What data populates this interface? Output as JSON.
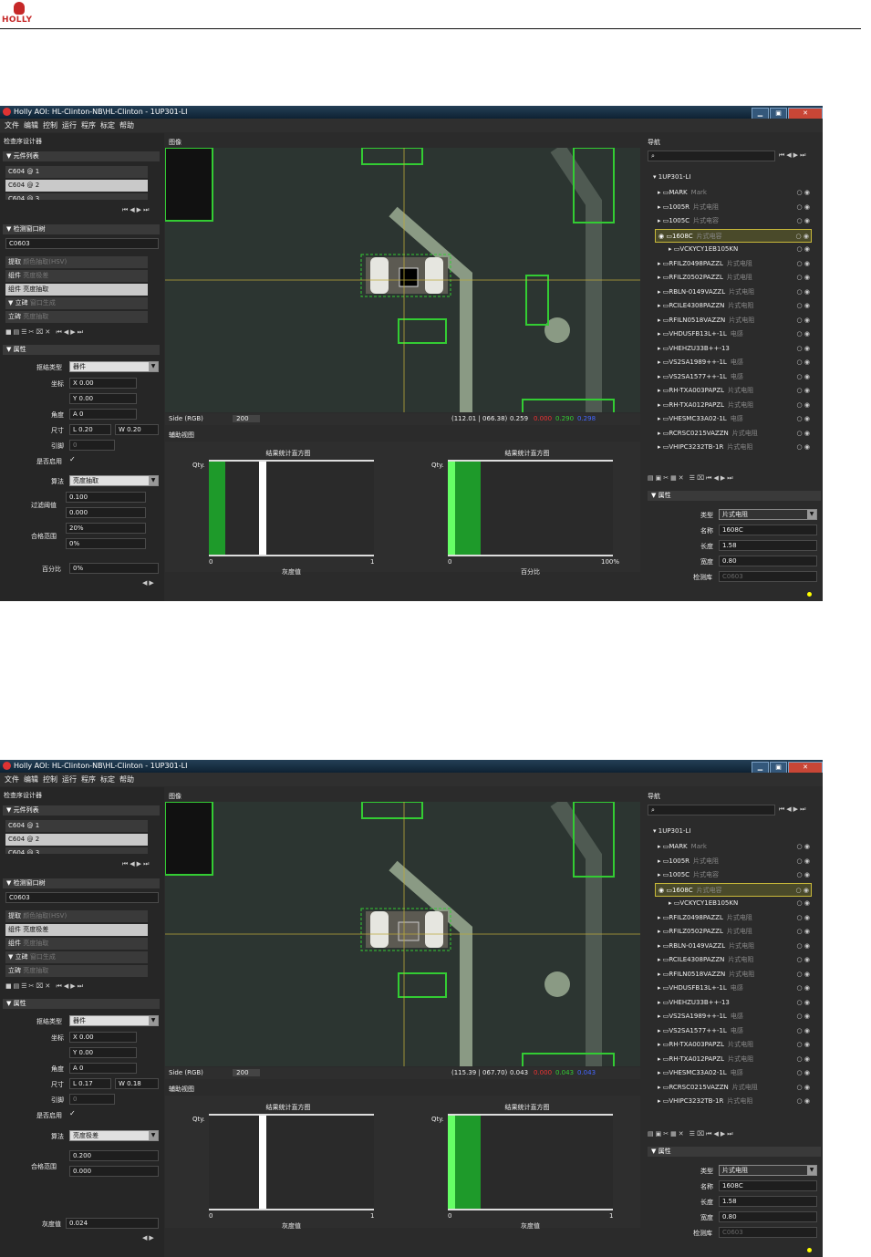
{
  "brand": "HOLLY",
  "app": {
    "title": "Holly AOI: HL-Clinton-NB\\HL-Clinton - 1UP301-LI",
    "menus": [
      "文件",
      "编辑",
      "控制",
      "运行",
      "程序",
      "标定",
      "帮助"
    ],
    "sections": {
      "designer": "检查序设计器",
      "image": "图像",
      "nav": "导航",
      "aux": "辅助视图",
      "component_list": "▼ 元件列表",
      "window": "▼ 检测窗口树",
      "props": "▼ 属性",
      "nav_props": "▼ 属性"
    },
    "component_list": [
      "C604  @ 1",
      "C604  @ 2",
      "C604  @ 3"
    ],
    "package": "C0603",
    "tree": [
      {
        "name": "提取",
        "desc": "颜色抽取(HSV)"
      },
      {
        "name": "组件",
        "desc": "亮度极差"
      },
      {
        "name": "组件",
        "desc": "亮度抽取"
      },
      {
        "name": "▼ 立碑",
        "desc": "窗口生成"
      },
      {
        "name": "立碑",
        "desc": "亮度抽取"
      }
    ],
    "prop_labels": {
      "shape": "抠结类型",
      "coord": "坐标",
      "angle": "角度",
      "size": "尺寸",
      "index": "引脚",
      "enabled": "是否启用",
      "algo": "算法",
      "filter": "过滤阈值",
      "range": "合格范围",
      "percent": "百分比",
      "gray": "灰度值"
    },
    "shape_value": "器件",
    "side_label": "Side (RGB)",
    "side_value": "200",
    "hist_title": "结果统计直方图",
    "qty": "Qty.",
    "gray_label": "灰度值",
    "pct_label": "百分比",
    "nav_root": "1UP301-LI",
    "nav_items": [
      {
        "name": "MARK",
        "desc": "Mark"
      },
      {
        "name": "1005R",
        "desc": "片式电阻"
      },
      {
        "name": "1005C",
        "desc": "片式电容"
      },
      {
        "name": "1608C",
        "desc": "片式电容"
      },
      {
        "name": "VCKYCY1EB105KN",
        "desc": ""
      },
      {
        "name": "RFILZ0498PAZZL",
        "desc": "片式电阻"
      },
      {
        "name": "RFILZ0502PAZZL",
        "desc": "片式电阻"
      },
      {
        "name": "RBLN-0149VAZZL",
        "desc": "片式电阻"
      },
      {
        "name": "RCILE4308PAZZN",
        "desc": "片式电阻"
      },
      {
        "name": "RFILN0518VAZZN",
        "desc": "片式电阻"
      },
      {
        "name": "VHDUSFB13L+-1L",
        "desc": "电感"
      },
      {
        "name": "VHEHZU33B++-13",
        "desc": ""
      },
      {
        "name": "VS2SA1989++-1L",
        "desc": "电感"
      },
      {
        "name": "VS2SA1577++-1L",
        "desc": "电感"
      },
      {
        "name": "RH-TXA003PAPZL",
        "desc": "片式电阻"
      },
      {
        "name": "RH-TXA012PAPZL",
        "desc": "片式电阻"
      },
      {
        "name": "VHESMC33A02-1L",
        "desc": "电感"
      },
      {
        "name": "RCRSC0215VAZZN",
        "desc": "片式电阻"
      },
      {
        "name": "VHIPC3232TB-1R",
        "desc": "片式电阻"
      }
    ],
    "nav_props": {
      "type_label": "类型",
      "type_value": "片式电阻",
      "name_label": "名称",
      "name_value": "1608C",
      "len_label": "长度",
      "len_value": "1.58",
      "width_label": "宽度",
      "width_value": "0.80",
      "lib_label": "检测库",
      "lib_value": "C0603"
    }
  },
  "screen1": {
    "x": "0.00",
    "y": "0.00",
    "angle": "0",
    "l": "0.20",
    "w": "0.20",
    "index": "0",
    "algo": "亮度抽取",
    "filter_hi": "0.100",
    "filter_lo": "0.000",
    "range_hi": "20%",
    "range_lo": "0%",
    "percent": "0%",
    "coords": "(112.01 | 066.38)",
    "rgb": [
      "0.259",
      "0.000",
      "0.290",
      "0.298"
    ],
    "hist2_max": "100%"
  },
  "screen2": {
    "x": "0.00",
    "y": "0.00",
    "angle": "0",
    "l": "0.17",
    "w": "0.18",
    "index": "0",
    "algo": "亮度极差",
    "range_hi": "0.200",
    "range_lo": "0.000",
    "gray": "0.024",
    "coords": "(115.39 | 067.70)",
    "rgb": [
      "0.043",
      "0.000",
      "0.043",
      "0.043"
    ],
    "hist2_max": "1"
  },
  "axis": {
    "zero": "0",
    "one": "1"
  }
}
